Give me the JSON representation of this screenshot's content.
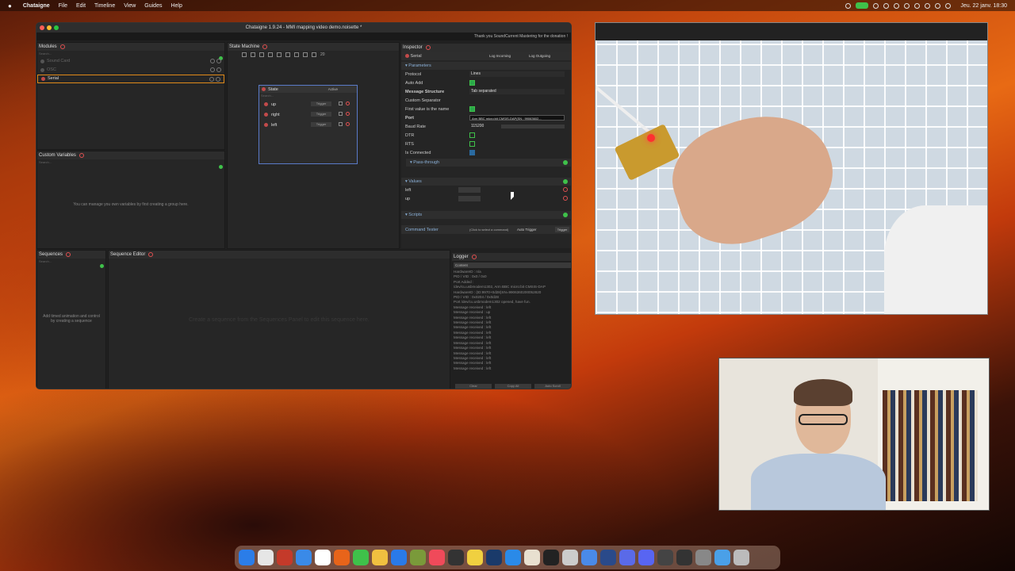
{
  "menubar": {
    "app_name": "Chataigne",
    "menus": [
      "File",
      "Edit",
      "Timeline",
      "View",
      "Guides",
      "Help"
    ],
    "clock": "Jeu. 22 janv. 18:30"
  },
  "window": {
    "title": "Chataigne 1.9.24 - MMI mapping video demo.noisette *",
    "notice": "Thank you SoundCurrent Mastering for the donation !"
  },
  "modules": {
    "title": "Modules",
    "search_placeholder": "Search...",
    "items": [
      {
        "label": "Sound Card",
        "selected": false
      },
      {
        "label": "OSC",
        "selected": false
      },
      {
        "label": "Serial",
        "selected": true
      }
    ]
  },
  "custom_variables": {
    "title": "Custom Variables",
    "search_placeholder": "Search...",
    "message": "You can manage you own variables by first creating a group here."
  },
  "state_machine": {
    "title": "State Machine",
    "zoom": "20",
    "state": {
      "name": "State",
      "status": "Active",
      "search_placeholder": "Search...",
      "triggers": [
        {
          "label": "up",
          "button": "Trigger"
        },
        {
          "label": "right",
          "button": "Trigger"
        },
        {
          "label": "left",
          "button": "Trigger"
        }
      ]
    }
  },
  "inspector": {
    "title": "Inspector",
    "module": "Serial",
    "log_incoming": "Log Incoming",
    "log_outgoing": "Log Outgoing",
    "parameters_header": "Parameters",
    "params": [
      {
        "label": "Protocol",
        "value": "Lines"
      },
      {
        "label": "Auto Add",
        "value": ""
      },
      {
        "label": "Message Structure",
        "value": "Tab separated"
      },
      {
        "label": "Custom Separator",
        "value": ""
      },
      {
        "label": "First value is the name",
        "value": ""
      },
      {
        "label": "Port",
        "value": "Arm BBC micro:bit CMSIS-DAP(SN : 99063602..."
      },
      {
        "label": "Baud Rate",
        "value": "115200"
      },
      {
        "label": "DTR",
        "value": ""
      },
      {
        "label": "RTS",
        "value": ""
      },
      {
        "label": "Is Connected",
        "value": ""
      }
    ],
    "passthrough_header": "Pass-through",
    "values_header": "Values",
    "values": [
      {
        "label": "left"
      },
      {
        "label": "up"
      }
    ],
    "scripts_header": "Scripts",
    "command_tester": "Command Tester",
    "command_placeholder": "(Click to select a command)",
    "auto_trigger": "Auto Trigger",
    "trigger_button": "Trigger"
  },
  "sequences": {
    "title": "Sequences",
    "search_placeholder": "Search...",
    "message": "Add timed animation and control by creating a sequence"
  },
  "sequence_editor": {
    "title": "Sequence Editor",
    "message": "Create a sequence from the Sequences Panel to edit this sequence here."
  },
  "logger": {
    "title": "Logger",
    "column": "Content",
    "lines": [
      "HardwareID : n/a",
      "PID / VID : 0x0 / 0x0",
      "Port Added :",
      "/dev/cu.usbmodem1302, Arm BBC micro:bit CMSIS-DAP",
      "HardwareID : (ID:9970+0d28)SN=9906360200052820",
      "PID / VID : 0x0204 / 0x0d28",
      "Port /dev/cu.usbmodem1302 opened, have fun.",
      "Message received : left",
      "Message received : up",
      "Message received : left",
      "Message received : left",
      "Message received : left",
      "Message received : left",
      "Message received : left",
      "Message received : left",
      "Message received : left",
      "Message received : left",
      "Message received : left",
      "Message received : left",
      "Message received : left"
    ],
    "buttons": [
      "Clear",
      "Copy All",
      "Auto Scroll"
    ]
  },
  "colors": {
    "accent_green": "#3fc14a",
    "selection_orange": "#e08a1a",
    "close_red": "#e05050",
    "section_blue": "#8ab0d8"
  }
}
